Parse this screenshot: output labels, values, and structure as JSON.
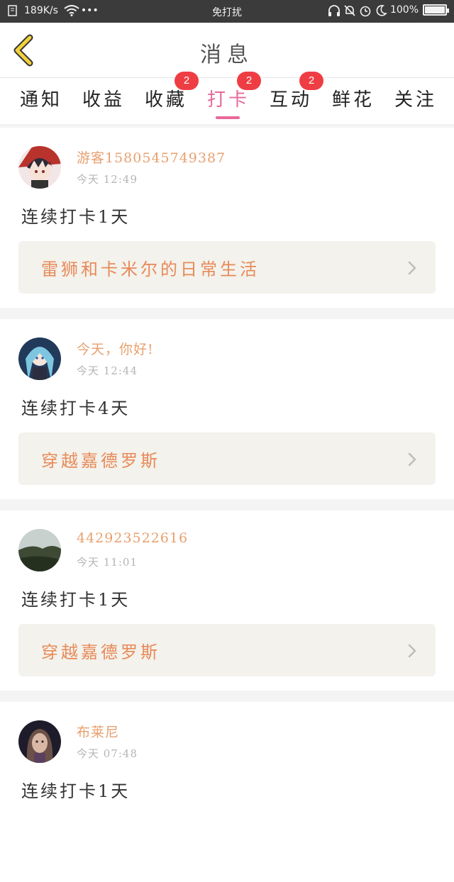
{
  "status_bar": {
    "speed": "189K/s",
    "dots": "•••",
    "app_name": "免打扰",
    "battery": "100%",
    "battery_level": 1.0
  },
  "header": {
    "title": "消息"
  },
  "tabs": [
    {
      "label": "通知",
      "badge": ""
    },
    {
      "label": "收益",
      "badge": ""
    },
    {
      "label": "收藏",
      "badge": "2"
    },
    {
      "label": "打卡",
      "badge": "2",
      "active": true
    },
    {
      "label": "互动",
      "badge": "2"
    },
    {
      "label": "鲜花",
      "badge": ""
    },
    {
      "label": "关注",
      "badge": ""
    }
  ],
  "colors": {
    "accent": "#e8689a",
    "badge": "#ef3d44",
    "username": "#e8a06f",
    "book_title": "#e88a59"
  },
  "feed": [
    {
      "username": "游客1580545749387",
      "time": "今天 12:49",
      "streak": "连续打卡1天",
      "book_title": "雷狮和卡米尔的日常生活"
    },
    {
      "username": "今天，你好!",
      "time": "今天 12:44",
      "streak": "连续打卡4天",
      "book_title": "穿越嘉德罗斯"
    },
    {
      "username": "442923522616",
      "time": "今天 11:01",
      "streak": "连续打卡1天",
      "book_title": "穿越嘉德罗斯"
    },
    {
      "username": "布莱尼",
      "time": "今天 07:48",
      "streak": "连续打卡1天",
      "book_title": ""
    }
  ]
}
